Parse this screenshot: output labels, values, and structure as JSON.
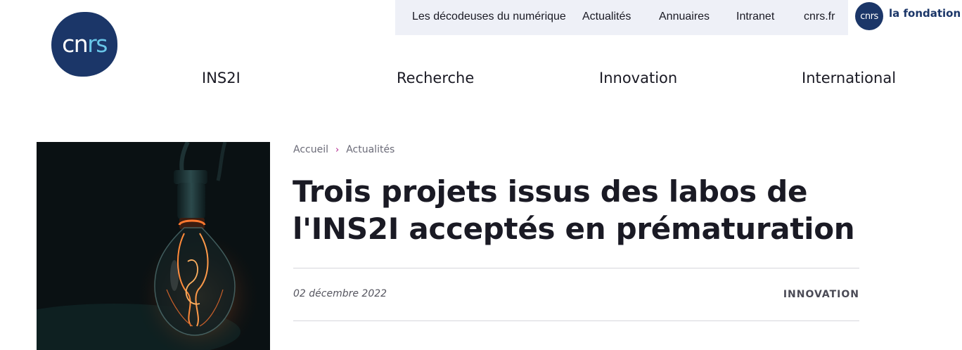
{
  "topbar": {
    "links": [
      "Les décodeuses du numérique",
      "Actualités",
      "Annuaires",
      "Intranet",
      "cnrs.fr"
    ],
    "fondation_logo": "cnrs",
    "fondation_label": "la fondation"
  },
  "logo": {
    "text_main": "cn",
    "text_accent": "rs"
  },
  "mainnav": [
    "INS2I",
    "Recherche",
    "Innovation",
    "International"
  ],
  "breadcrumb": {
    "home": "Accueil",
    "separator": "›",
    "current": "Actualités"
  },
  "article": {
    "title_line1": "Trois projets issus des labos de",
    "title_line2": "l'INS2I acceptés en prématuration",
    "date": "02 décembre 2022",
    "category": "INNOVATION"
  },
  "colors": {
    "brand": "#1b3668",
    "logo_accent": "#69c6e8",
    "breadcrumb_separator": "#b0208a",
    "topbar_bg": "#eef0f7"
  }
}
